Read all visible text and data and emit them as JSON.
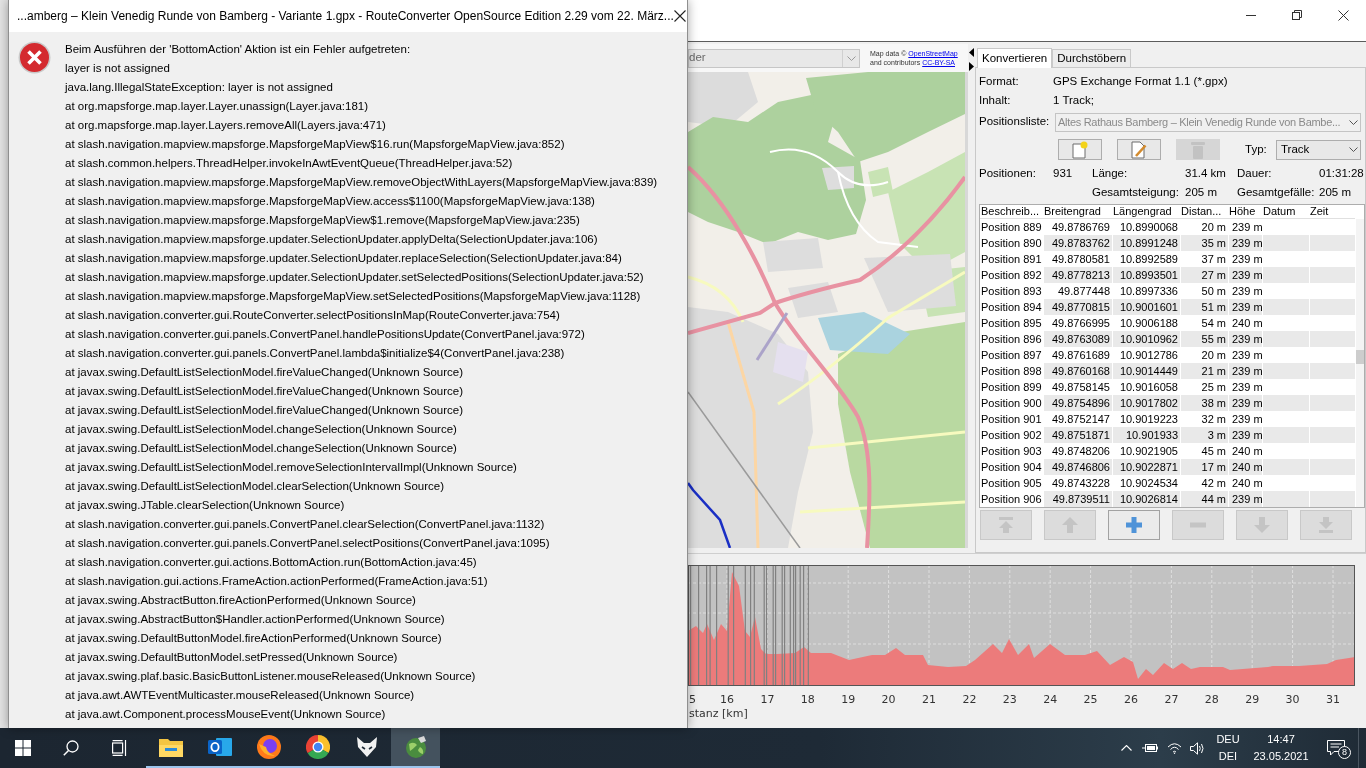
{
  "dialog": {
    "title": "...amberg – Klein Venedig Runde von Bamberg - Variante 1.gpx - RouteConverter OpenSource Edition 2.29 vom 22. März...",
    "lines": [
      "Beim Ausführen der 'BottomAction' Aktion ist ein Fehler aufgetreten:",
      "layer is not assigned",
      "java.lang.IllegalStateException: layer is not assigned",
      "at org.mapsforge.map.layer.Layer.unassign(Layer.java:181)",
      "at org.mapsforge.map.layer.Layers.removeAll(Layers.java:471)",
      "at slash.navigation.mapview.mapsforge.MapsforgeMapView$16.run(MapsforgeMapView.java:852)",
      "at slash.common.helpers.ThreadHelper.invokeInAwtEventQueue(ThreadHelper.java:52)",
      "at slash.navigation.mapview.mapsforge.MapsforgeMapView.removeObjectWithLayers(MapsforgeMapView.java:839)",
      "at slash.navigation.mapview.mapsforge.MapsforgeMapView.access$1100(MapsforgeMapView.java:138)",
      "at slash.navigation.mapview.mapsforge.MapsforgeMapView$1.remove(MapsforgeMapView.java:235)",
      "at slash.navigation.mapview.mapsforge.updater.SelectionUpdater.applyDelta(SelectionUpdater.java:106)",
      "at slash.navigation.mapview.mapsforge.updater.SelectionUpdater.replaceSelection(SelectionUpdater.java:84)",
      "at slash.navigation.mapview.mapsforge.updater.SelectionUpdater.setSelectedPositions(SelectionUpdater.java:52)",
      "at slash.navigation.mapview.mapsforge.MapsforgeMapView.setSelectedPositions(MapsforgeMapView.java:1128)",
      "at slash.navigation.converter.gui.RouteConverter.selectPositionsInMap(RouteConverter.java:754)",
      "at slash.navigation.converter.gui.panels.ConvertPanel.handlePositionsUpdate(ConvertPanel.java:972)",
      "at slash.navigation.converter.gui.panels.ConvertPanel.lambda$initialize$4(ConvertPanel.java:238)",
      "at javax.swing.DefaultListSelectionModel.fireValueChanged(Unknown Source)",
      "at javax.swing.DefaultListSelectionModel.fireValueChanged(Unknown Source)",
      "at javax.swing.DefaultListSelectionModel.fireValueChanged(Unknown Source)",
      "at javax.swing.DefaultListSelectionModel.changeSelection(Unknown Source)",
      "at javax.swing.DefaultListSelectionModel.changeSelection(Unknown Source)",
      "at javax.swing.DefaultListSelectionModel.removeSelectionIntervalImpl(Unknown Source)",
      "at javax.swing.DefaultListSelectionModel.clearSelection(Unknown Source)",
      "at javax.swing.JTable.clearSelection(Unknown Source)",
      "at slash.navigation.converter.gui.panels.ConvertPanel.clearSelection(ConvertPanel.java:1132)",
      "at slash.navigation.converter.gui.panels.ConvertPanel.selectPositions(ConvertPanel.java:1095)",
      "at slash.navigation.converter.gui.actions.BottomAction.run(BottomAction.java:45)",
      "at slash.navigation.gui.actions.FrameAction.actionPerformed(FrameAction.java:51)",
      "at javax.swing.AbstractButton.fireActionPerformed(Unknown Source)",
      "at javax.swing.AbstractButton$Handler.actionPerformed(Unknown Source)",
      "at javax.swing.DefaultButtonModel.fireActionPerformed(Unknown Source)",
      "at javax.swing.DefaultButtonModel.setPressed(Unknown Source)",
      "at javax.swing.plaf.basic.BasicButtonListener.mouseReleased(Unknown Source)",
      "at java.awt.AWTEventMulticaster.mouseReleased(Unknown Source)",
      "at java.awt.Component.processMouseEvent(Unknown Source)"
    ]
  },
  "map": {
    "search_value": "der",
    "attribution": [
      {
        "text": "Map data ©",
        "link": "OpenStreetMap"
      },
      {
        "text": "and contributors",
        "link": "CC-BY-SA"
      }
    ]
  },
  "tabs": [
    {
      "label": "Konvertieren",
      "selected": true
    },
    {
      "label": "Durchstöbern",
      "selected": false
    }
  ],
  "form": {
    "format_label": "Format:",
    "format_value": "GPS Exchange Format 1.1 (*.gpx)",
    "content_label": "Inhalt:",
    "content_value": "1 Track;",
    "list_label": "Positionsliste:",
    "list_value": "Altes Rathaus Bamberg – Klein Venedig Runde von Bambe...",
    "list_disabled": true,
    "toolbar_buttons": [
      {
        "kind": "new",
        "disabled": false
      },
      {
        "kind": "edit",
        "disabled": false
      },
      {
        "kind": "delete",
        "disabled": true
      }
    ],
    "type_label": "Typ:",
    "type_value": "Track"
  },
  "stats": {
    "positions": {
      "label": "Positionen:",
      "value": "931"
    },
    "length": {
      "label": "Länge:",
      "value": "31.4 km"
    },
    "duration": {
      "label": "Dauer:",
      "value": "01:31:28"
    },
    "ascent": {
      "label": "Gesamtsteigung:",
      "value": "205 m"
    },
    "descent": {
      "label": "Gesamtgefälle:",
      "value": "205 m"
    }
  },
  "table": {
    "columns": [
      "Beschreib...",
      "Breitengrad",
      "Längengrad",
      "Distan...",
      "Höhe",
      "Datum",
      "Zeit"
    ],
    "rows": [
      [
        "Position 889",
        "49.8786769",
        "10.8990068",
        "20 m",
        "239 m"
      ],
      [
        "Position 890",
        "49.8783762",
        "10.8991248",
        "35 m",
        "239 m"
      ],
      [
        "Position 891",
        "49.8780581",
        "10.8992589",
        "37 m",
        "239 m"
      ],
      [
        "Position 892",
        "49.8778213",
        "10.8993501",
        "27 m",
        "239 m"
      ],
      [
        "Position 893",
        "49.877448",
        "10.8997336",
        "50 m",
        "239 m"
      ],
      [
        "Position 894",
        "49.8770815",
        "10.9001601",
        "51 m",
        "239 m"
      ],
      [
        "Position 895",
        "49.8766995",
        "10.9006188",
        "54 m",
        "240 m"
      ],
      [
        "Position 896",
        "49.8763089",
        "10.9010962",
        "55 m",
        "239 m"
      ],
      [
        "Position 897",
        "49.8761689",
        "10.9012786",
        "20 m",
        "239 m"
      ],
      [
        "Position 898",
        "49.8760168",
        "10.9014449",
        "21 m",
        "239 m"
      ],
      [
        "Position 899",
        "49.8758145",
        "10.9016058",
        "25 m",
        "239 m"
      ],
      [
        "Position 900",
        "49.8754896",
        "10.9017802",
        "38 m",
        "239 m"
      ],
      [
        "Position 901",
        "49.8752147",
        "10.9019223",
        "32 m",
        "239 m"
      ],
      [
        "Position 902",
        "49.8751871",
        "10.901933",
        "3 m",
        "239 m"
      ],
      [
        "Position 903",
        "49.8748206",
        "10.9021905",
        "45 m",
        "240 m"
      ],
      [
        "Position 904",
        "49.8746806",
        "10.9022871",
        "17 m",
        "240 m"
      ],
      [
        "Position 905",
        "49.8743228",
        "10.9024534",
        "42 m",
        "240 m"
      ],
      [
        "Position 906",
        "49.8739511",
        "10.9026814",
        "44 m",
        "239 m"
      ]
    ]
  },
  "position_buttons": [
    {
      "kind": "top",
      "disabled": true
    },
    {
      "kind": "up",
      "disabled": true
    },
    {
      "kind": "add",
      "disabled": false
    },
    {
      "kind": "remove",
      "disabled": true
    },
    {
      "kind": "down",
      "disabled": true
    },
    {
      "kind": "bottom",
      "disabled": true
    }
  ],
  "elevation_profile": {
    "tick_labels": [
      "5",
      "16",
      "17",
      "18",
      "19",
      "20",
      "21",
      "22",
      "23",
      "24",
      "25",
      "26",
      "27",
      "28",
      "29",
      "30",
      "31"
    ],
    "axis_title": "stanz [km]"
  },
  "taskbar": {
    "apps": [
      {
        "kind": "folder",
        "running": true,
        "selected": false
      },
      {
        "kind": "mail",
        "running": true,
        "selected": false
      },
      {
        "kind": "fox-browser",
        "running": true,
        "selected": false
      },
      {
        "kind": "ring-browser",
        "running": true,
        "selected": false
      },
      {
        "kind": "fox-head",
        "running": true,
        "selected": false
      },
      {
        "kind": "globe",
        "running": true,
        "selected": true
      }
    ],
    "language": {
      "line1": "DEU",
      "line2": "DEI"
    },
    "clock": {
      "time": "14:47",
      "date": "23.05.2021"
    },
    "notification_count": "8"
  }
}
